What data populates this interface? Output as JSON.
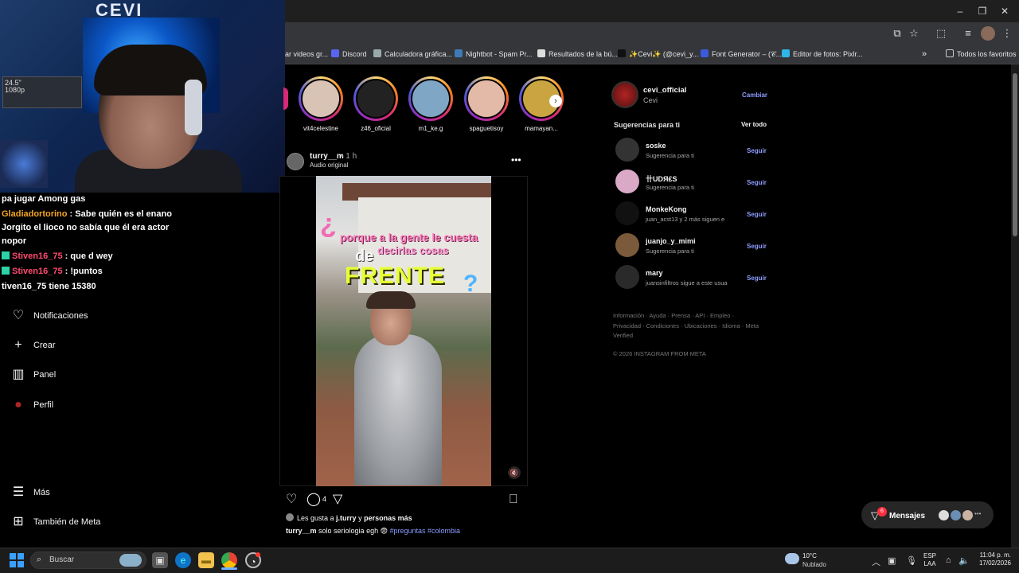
{
  "browser": {
    "bookmarks": [
      {
        "label": "ar videos gr...",
        "color": "#444"
      },
      {
        "label": "Discord",
        "color": "#5865f2"
      },
      {
        "label": "Calculadora gráfica...",
        "color": "#9aa"
      },
      {
        "label": "Nightbot - Spam Pr...",
        "color": "#3e7bb5"
      },
      {
        "label": "Resultados de la bú...",
        "color": "#ddd"
      },
      {
        "label": "✨Cevi✨ (@cevi_y...",
        "color": "#111"
      },
      {
        "label": "Font Generator – (𝒞...",
        "color": "#3b5bdb"
      },
      {
        "label": "Editor de fotos: Pixlr...",
        "color": "#2eb6e8"
      }
    ],
    "all_bookmarks": "Todos los favoritos"
  },
  "chat": [
    {
      "user": "",
      "text": "pa jugar Among gas",
      "user_color": "#ffffff"
    },
    {
      "user": "Gladiadortorino",
      "text": " : Sabe quién es el enano",
      "user_color": "#f5a623"
    },
    {
      "user": "",
      "text": "Jorgito el lioco no sabía que él era actor",
      "user_color": "#ffffff"
    },
    {
      "user": "",
      "text": "nopor",
      "user_color": "#ffffff"
    },
    {
      "user": "Stiven16_75",
      "text": " : que d wey",
      "user_color": "#ff4a6e"
    },
    {
      "user": "Stiven16_75",
      "text": " : !puntos",
      "user_color": "#ff4a6e"
    },
    {
      "user": "",
      "text": "tiven16_75 tiene 15380",
      "user_color": "#ffffff"
    }
  ],
  "sidebar": {
    "items": [
      {
        "label": "Notificaciones",
        "icon": "♡"
      },
      {
        "label": "Crear",
        "icon": "+"
      },
      {
        "label": "Panel",
        "icon": "▥"
      },
      {
        "label": "Perfil",
        "icon": "●"
      },
      {
        "label": "Más",
        "icon": "☰"
      },
      {
        "label": "También de Meta",
        "icon": "⊞"
      }
    ]
  },
  "stories": [
    {
      "name": "vit4celestine",
      "color": "#d9c3b5"
    },
    {
      "name": "z46_oficial",
      "color": "#222"
    },
    {
      "name": "m1_ke.g",
      "color": "#7fa6c4"
    },
    {
      "name": "spaguetisoy",
      "color": "#e3b9a8"
    },
    {
      "name": "mamayan...",
      "color": "#c9a441"
    }
  ],
  "post": {
    "user": "turry__m",
    "time": "• 1 h",
    "audio": "Audio original",
    "video_text": {
      "q1": "¿",
      "line1": "porque a la gente le cuesta",
      "line2": "decirlas cosas",
      "line3": "de",
      "line4": "FRENTE",
      "q2": "?"
    },
    "comments": "4",
    "likes_prefix": "Les gusta a ",
    "likes_user": "j.turry",
    "likes_mid": " y ",
    "likes_suffix": "personas más",
    "caption_user": "turry__m",
    "caption_text": " solo seriologia egh 😨 ",
    "caption_tags": "#preguntas #colombia"
  },
  "profile": {
    "username": "cevi_official",
    "name": "Cevi",
    "switch": "Cambiar"
  },
  "suggestions": {
    "title": "Sugerencias para ti",
    "see_all": "Ver todo",
    "follow_label": "Seguir",
    "items": [
      {
        "user": "soske",
        "sub": "Sugerencia para ti",
        "color": "#333"
      },
      {
        "user": "卄UDЯ₤S",
        "sub": "Sugerencia para ti",
        "color": "#d9a9c6"
      },
      {
        "user": "MonkeKong",
        "sub": "juan_acst13 y 2 más siguen e",
        "color": "#111"
      },
      {
        "user": "juanjo_y_mimi",
        "sub": "Sugerencia para ti",
        "color": "#7a5a3a"
      },
      {
        "user": "mary",
        "sub": "juansinfiltros sigue a este usua",
        "color": "#2a2a2a"
      }
    ]
  },
  "footer": {
    "links": "Información · Ayuda · Prensa · API · Empleo · Privacidad · Condiciones · Ubicaciones · Idioma · Meta Verified",
    "copyright": "© 2026 INSTAGRAM FROM META"
  },
  "messages": {
    "label": "Mensajes",
    "badge": "6"
  },
  "taskbar": {
    "search": "Buscar",
    "weather_temp": "10°C",
    "weather_desc": "Nublado",
    "lang1": "ESP",
    "lang2": "LAA",
    "time": "11:04 p. m.",
    "date": "17/02/2026"
  }
}
